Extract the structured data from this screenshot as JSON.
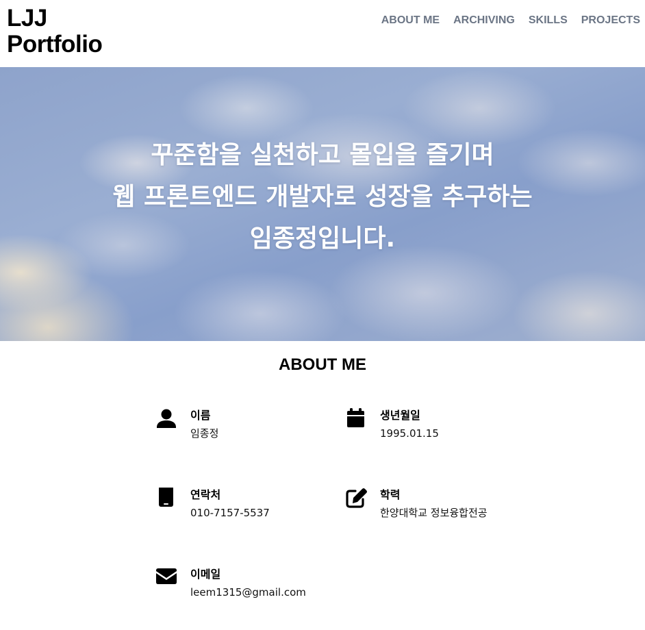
{
  "header": {
    "logo_line1": "LJJ",
    "logo_line2": "Portfolio",
    "nav": [
      {
        "label": "ABOUT ME"
      },
      {
        "label": "ARCHIVING"
      },
      {
        "label": "SKILLS"
      },
      {
        "label": "PROJECTS"
      }
    ]
  },
  "hero": {
    "lines": [
      "꾸준함을 실천하고 몰입을 즐기며",
      "웹 프론트엔드 개발자로 성장을 추구하는",
      "임종정입니다."
    ]
  },
  "about": {
    "title": "ABOUT ME",
    "items": [
      {
        "icon": "user-icon",
        "label": "이름",
        "value": "임종정"
      },
      {
        "icon": "calendar-icon",
        "label": "생년월일",
        "value": "1995.01.15"
      },
      {
        "icon": "mobile-phone-icon",
        "label": "연락처",
        "value": "010-7157-5537"
      },
      {
        "icon": "edit-icon",
        "label": "학력",
        "value": "한양대학교 정보융합전공"
      },
      {
        "icon": "envelope-icon",
        "label": "이메일",
        "value": "leem1315@gmail.com"
      }
    ]
  },
  "colors": {
    "nav_text": "#6b7585",
    "hero_text": "#ffffff",
    "sky": "#8ea3cb"
  }
}
